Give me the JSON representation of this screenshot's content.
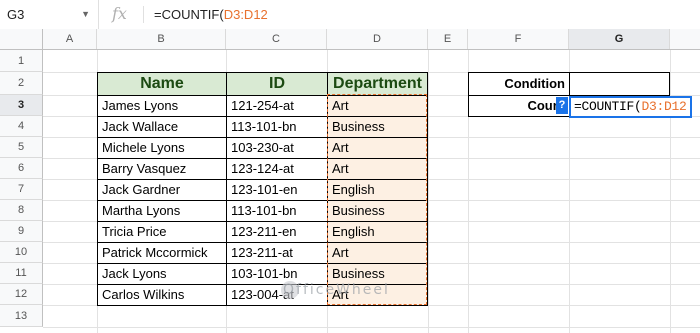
{
  "formula_bar": {
    "name_box": "G3",
    "fx_label": "fx",
    "formula_prefix": "=COUNTIF(",
    "formula_ref": "D3:D12"
  },
  "columns": [
    "A",
    "B",
    "C",
    "D",
    "E",
    "F",
    "G"
  ],
  "rows": [
    "1",
    "2",
    "3",
    "4",
    "5",
    "6",
    "7",
    "8",
    "9",
    "10",
    "11",
    "12",
    "13"
  ],
  "table": {
    "headers": [
      "Name",
      "ID",
      "Department"
    ],
    "rows": [
      [
        "James Lyons",
        "121-254-at",
        "Art"
      ],
      [
        "Jack Wallace",
        "113-101-bn",
        "Business"
      ],
      [
        "Michele Lyons",
        "103-230-at",
        "Art"
      ],
      [
        "Barry Vasquez",
        "123-124-at",
        "Art"
      ],
      [
        "Jack Gardner",
        "123-101-en",
        "English"
      ],
      [
        "Martha Lyons",
        "113-101-bn",
        "Business"
      ],
      [
        "Tricia Price",
        "123-211-en",
        "English"
      ],
      [
        "Patrick Mccormick",
        "123-211-at",
        "Art"
      ],
      [
        "Jack Lyons",
        "103-101-bn",
        "Business"
      ],
      [
        "Carlos Wilkins",
        "123-004-at",
        "Art"
      ]
    ]
  },
  "criteria": {
    "condition_label": "Condition",
    "condition_value": "",
    "count_label": "Count",
    "edit_prefix": "=COUNTIF(",
    "edit_ref": "D3:D12",
    "help_icon": "?"
  },
  "watermark": "OfficeWheel",
  "colors": {
    "header_fill": "#d9ead3",
    "dept_fill": "#fdf0e3",
    "reference": "#e8712e",
    "selection": "#1a73e8"
  }
}
